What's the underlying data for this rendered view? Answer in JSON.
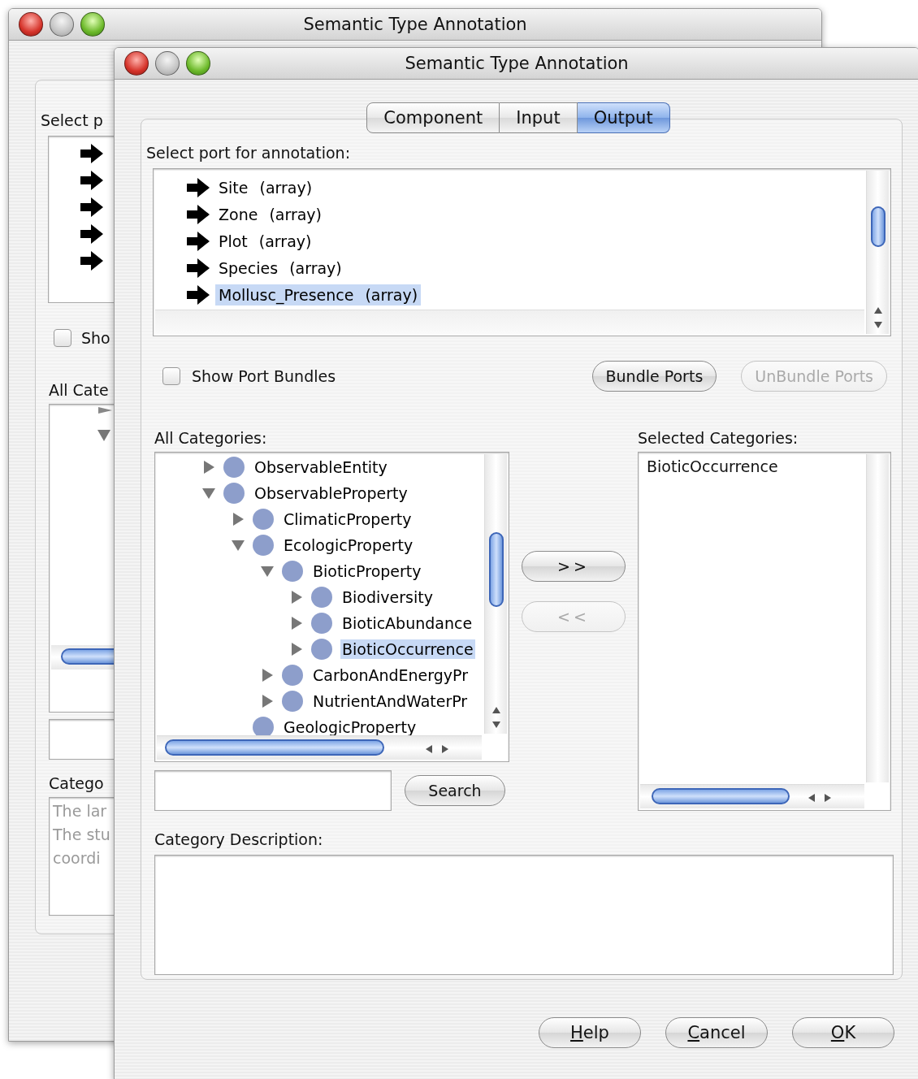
{
  "back_window": {
    "title": "Semantic Type Annotation",
    "port_label": "Select p",
    "show_bundles": {
      "label": "Sho",
      "checked": false
    },
    "categories_label": "All Cate",
    "description_label": "Catego",
    "description_lines": [
      "The lar",
      "The stu",
      "coordi"
    ]
  },
  "window": {
    "title": "Semantic Type Annotation"
  },
  "tabs": [
    {
      "label": "Component",
      "selected": false
    },
    {
      "label": "Input",
      "selected": false
    },
    {
      "label": "Output",
      "selected": true
    }
  ],
  "port_label": "Select port for annotation:",
  "ports": [
    {
      "name": "Site",
      "type": "(array)",
      "selected": false
    },
    {
      "name": "Zone",
      "type": "(array)",
      "selected": false
    },
    {
      "name": "Plot",
      "type": "(array)",
      "selected": false
    },
    {
      "name": "Species",
      "type": "(array)",
      "selected": false
    },
    {
      "name": "Mollusc_Presence",
      "type": "(array)",
      "selected": true
    }
  ],
  "show_bundles": {
    "label": "Show Port Bundles",
    "checked": false
  },
  "bundle_buttons": [
    {
      "label": "Bundle Ports",
      "disabled": false
    },
    {
      "label": "UnBundle Ports",
      "disabled": true
    }
  ],
  "categories_label": "All Categories:",
  "categories": [
    {
      "label": "ObservableEntity",
      "expanded": false,
      "selected": false
    },
    {
      "label": "ObservableProperty",
      "expanded": true,
      "selected": false,
      "children": [
        {
          "label": "ClimaticProperty",
          "expanded": false,
          "selected": false
        },
        {
          "label": "EcologicProperty",
          "expanded": true,
          "selected": false,
          "children": [
            {
              "label": "BioticProperty",
              "expanded": true,
              "selected": false,
              "children": [
                {
                  "label": "Biodiversity",
                  "expanded": false,
                  "selected": false
                },
                {
                  "label": "BioticAbundance",
                  "expanded": false,
                  "selected": false
                },
                {
                  "label": "BioticOccurrence",
                  "expanded": false,
                  "selected": true
                }
              ]
            },
            {
              "label": "CarbonAndEnergyPr",
              "expanded": false,
              "selected": false
            },
            {
              "label": "NutrientAndWaterPr",
              "expanded": false,
              "selected": false
            }
          ]
        },
        {
          "label": "GeologicProperty",
          "selected": false
        }
      ]
    }
  ],
  "move_buttons": [
    {
      "label": ">>",
      "disabled": false
    },
    {
      "label": "<<",
      "disabled": true
    }
  ],
  "search_button": {
    "label": "Search"
  },
  "selected_label": "Selected Categories:",
  "selected_categories": [
    "BioticOccurrence"
  ],
  "description_label": "Category Description:",
  "buttons": [
    {
      "label": "Help",
      "mnemonic": true
    },
    {
      "label": "Cancel",
      "mnemonic": true
    },
    {
      "label": "OK",
      "mnemonic": true
    }
  ]
}
